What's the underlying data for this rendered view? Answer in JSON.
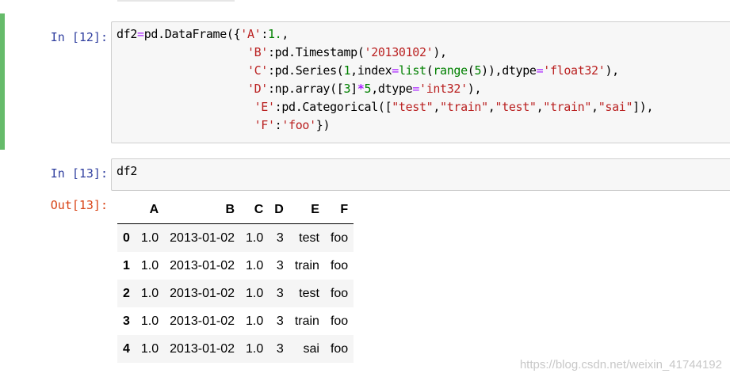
{
  "cell12": {
    "prompt": "In  [12]:",
    "code": [
      [
        [
          "t",
          "df2"
        ],
        [
          "eq",
          "="
        ],
        [
          "t",
          "pd.DataFrame({"
        ],
        [
          "str",
          "'A'"
        ],
        [
          "t",
          ":"
        ],
        [
          "num",
          "1."
        ],
        [
          "t",
          ","
        ]
      ],
      [
        [
          "t",
          "                   "
        ],
        [
          "str",
          "'B'"
        ],
        [
          "t",
          ":pd.Timestamp("
        ],
        [
          "str",
          "'20130102'"
        ],
        [
          "t",
          "),"
        ]
      ],
      [
        [
          "t",
          "                   "
        ],
        [
          "str",
          "'C'"
        ],
        [
          "t",
          ":pd.Series("
        ],
        [
          "num",
          "1"
        ],
        [
          "t",
          ",index"
        ],
        [
          "eq",
          "="
        ],
        [
          "kw",
          "list"
        ],
        [
          "t",
          "("
        ],
        [
          "kw",
          "range"
        ],
        [
          "t",
          "("
        ],
        [
          "num",
          "5"
        ],
        [
          "t",
          ")),dtype"
        ],
        [
          "eq",
          "="
        ],
        [
          "str",
          "'float32'"
        ],
        [
          "t",
          "),"
        ]
      ],
      [
        [
          "t",
          "                   "
        ],
        [
          "str",
          "'D'"
        ],
        [
          "t",
          ":np.array(["
        ],
        [
          "num",
          "3"
        ],
        [
          "t",
          "]"
        ],
        [
          "op",
          "*"
        ],
        [
          "num",
          "5"
        ],
        [
          "t",
          ",dtype"
        ],
        [
          "eq",
          "="
        ],
        [
          "str",
          "'int32'"
        ],
        [
          "t",
          "),"
        ]
      ],
      [
        [
          "t",
          "                    "
        ],
        [
          "str",
          "'E'"
        ],
        [
          "t",
          ":pd.Categorical(["
        ],
        [
          "str",
          "\"test\""
        ],
        [
          "t",
          ","
        ],
        [
          "str",
          "\"train\""
        ],
        [
          "t",
          ","
        ],
        [
          "str",
          "\"test\""
        ],
        [
          "t",
          ","
        ],
        [
          "str",
          "\"train\""
        ],
        [
          "t",
          ","
        ],
        [
          "str",
          "\"sai\""
        ],
        [
          "t",
          "]),"
        ]
      ],
      [
        [
          "t",
          "                    "
        ],
        [
          "str",
          "'F'"
        ],
        [
          "t",
          ":"
        ],
        [
          "str",
          "'foo'"
        ],
        [
          "t",
          "})"
        ]
      ]
    ]
  },
  "cell13": {
    "prompt": "In  [13]:",
    "code": [
      [
        [
          "t",
          "df2"
        ]
      ]
    ],
    "out_prompt": "Out[13]:"
  },
  "dataframe": {
    "columns": [
      "",
      "A",
      "B",
      "C",
      "D",
      "E",
      "F"
    ],
    "rows": [
      [
        "0",
        "1.0",
        "2013-01-02",
        "1.0",
        "3",
        "test",
        "foo"
      ],
      [
        "1",
        "1.0",
        "2013-01-02",
        "1.0",
        "3",
        "train",
        "foo"
      ],
      [
        "2",
        "1.0",
        "2013-01-02",
        "1.0",
        "3",
        "test",
        "foo"
      ],
      [
        "3",
        "1.0",
        "2013-01-02",
        "1.0",
        "3",
        "train",
        "foo"
      ],
      [
        "4",
        "1.0",
        "2013-01-02",
        "1.0",
        "3",
        "sai",
        "foo"
      ]
    ]
  },
  "watermark": "https://blog.csdn.net/weixin_41744192",
  "colors": {
    "selected_bar": "#66bb6a",
    "in_prompt": "#303f9f",
    "out_prompt": "#d84315",
    "string": "#ba2121",
    "number": "#008000",
    "operator": "#aa22ff"
  }
}
